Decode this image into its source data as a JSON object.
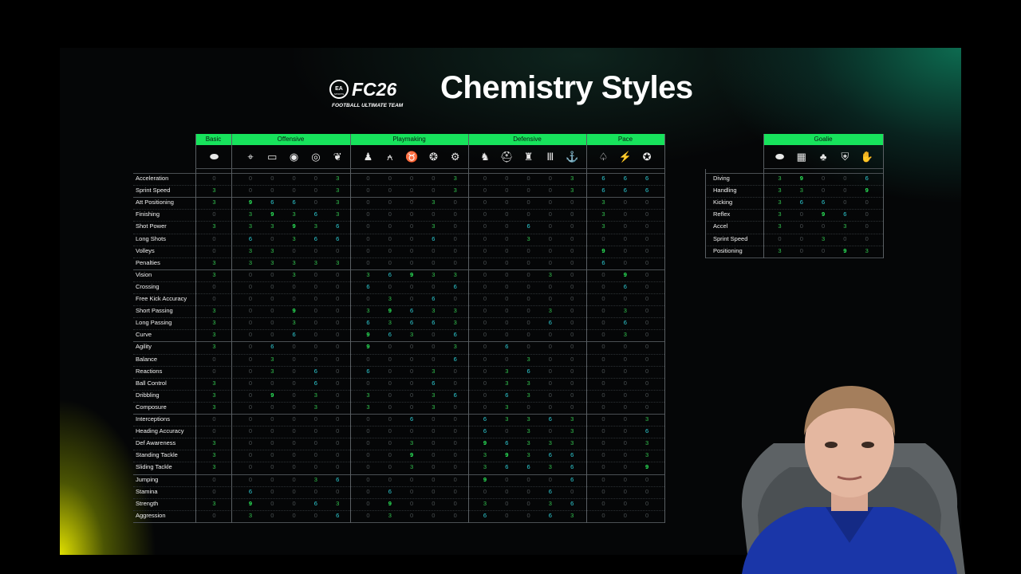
{
  "header": {
    "title": "Chemistry Styles",
    "logo_brand": "FC26",
    "logo_sub": "FOOTBALL ULTIMATE TEAM",
    "logo_top": "EA SPORTS"
  },
  "colors": {
    "accent_green": "#17e35c",
    "three": "#33c24f",
    "six": "#2fd0d8",
    "nine": "#2bea5a",
    "zero": "#4a5052"
  },
  "groups": [
    "Basic",
    "Offensive",
    "Playmaking",
    "Defensive",
    "Pace"
  ],
  "goalie_group": "Goalie",
  "outfield_icons": [
    "boot-icon",
    "crosshair-icon",
    "goal-icon",
    "eye-icon",
    "target-icon",
    "wings-icon",
    "pawn-icon",
    "compass-icon",
    "bull-icon",
    "brain-icon",
    "engine-icon",
    "knight-icon",
    "helmet-icon",
    "soldier-icon",
    "pillar-icon",
    "anchor-icon",
    "fox-icon",
    "lightning-icon",
    "bolt-icon"
  ],
  "goalie_icons": [
    "boot-icon",
    "wall-icon",
    "cat-icon",
    "shield-icon",
    "glove-icon"
  ],
  "outfield_attrs": [
    "Acceleration",
    "Sprint Speed",
    "Att Positioning",
    "Finishing",
    "Shot Power",
    "Long Shots",
    "Volleys",
    "Penalties",
    "Vision",
    "Crossing",
    "Free Kick Accuracy",
    "Short Passing",
    "Long Passing",
    "Curve",
    "Agility",
    "Balance",
    "Reactions",
    "Ball Control",
    "Dribbling",
    "Composure",
    "Interceptions",
    "Heading Accuracy",
    "Def Awareness",
    "Standing Tackle",
    "Sliding Tackle",
    "Jumping",
    "Stamina",
    "Strength",
    "Aggression"
  ],
  "outfield_values": [
    [
      "0",
      "0",
      "0",
      "0",
      "0",
      "3",
      "0",
      "0",
      "0",
      "0",
      "3",
      "0",
      "0",
      "0",
      "0",
      "3",
      "6",
      "6",
      "6"
    ],
    [
      "3",
      "0",
      "0",
      "0",
      "0",
      "3",
      "0",
      "0",
      "0",
      "0",
      "3",
      "0",
      "0",
      "0",
      "0",
      "3",
      "6",
      "6",
      "6"
    ],
    [
      "3",
      "9",
      "6",
      "6",
      "0",
      "3",
      "0",
      "0",
      "0",
      "3",
      "0",
      "0",
      "0",
      "0",
      "0",
      "0",
      "3",
      "0",
      "0"
    ],
    [
      "0",
      "3",
      "9",
      "3",
      "6",
      "3",
      "0",
      "0",
      "0",
      "0",
      "0",
      "0",
      "0",
      "0",
      "0",
      "0",
      "3",
      "0",
      "0"
    ],
    [
      "3",
      "3",
      "3",
      "9",
      "3",
      "6",
      "0",
      "0",
      "0",
      "3",
      "0",
      "0",
      "0",
      "6",
      "0",
      "0",
      "3",
      "0",
      "0"
    ],
    [
      "0",
      "6",
      "0",
      "3",
      "6",
      "6",
      "0",
      "0",
      "0",
      "6",
      "0",
      "0",
      "0",
      "3",
      "0",
      "0",
      "0",
      "0",
      "0"
    ],
    [
      "0",
      "3",
      "3",
      "0",
      "0",
      "0",
      "0",
      "0",
      "0",
      "0",
      "0",
      "0",
      "0",
      "0",
      "0",
      "0",
      "9",
      "0",
      "0"
    ],
    [
      "3",
      "3",
      "3",
      "3",
      "3",
      "3",
      "0",
      "0",
      "0",
      "0",
      "0",
      "0",
      "0",
      "0",
      "0",
      "0",
      "6",
      "0",
      "0"
    ],
    [
      "3",
      "0",
      "0",
      "3",
      "0",
      "0",
      "3",
      "6",
      "9",
      "3",
      "3",
      "0",
      "0",
      "0",
      "3",
      "0",
      "0",
      "9",
      "0"
    ],
    [
      "0",
      "0",
      "0",
      "0",
      "0",
      "0",
      "6",
      "0",
      "0",
      "0",
      "6",
      "0",
      "0",
      "0",
      "0",
      "0",
      "0",
      "6",
      "0"
    ],
    [
      "0",
      "0",
      "0",
      "0",
      "0",
      "0",
      "0",
      "3",
      "0",
      "6",
      "0",
      "0",
      "0",
      "0",
      "0",
      "0",
      "0",
      "0",
      "0"
    ],
    [
      "3",
      "0",
      "0",
      "9",
      "0",
      "0",
      "3",
      "9",
      "6",
      "3",
      "3",
      "0",
      "0",
      "0",
      "3",
      "0",
      "0",
      "3",
      "0"
    ],
    [
      "3",
      "0",
      "0",
      "3",
      "0",
      "0",
      "6",
      "3",
      "6",
      "6",
      "3",
      "0",
      "0",
      "0",
      "6",
      "0",
      "0",
      "6",
      "0"
    ],
    [
      "3",
      "0",
      "0",
      "6",
      "0",
      "0",
      "9",
      "6",
      "3",
      "0",
      "6",
      "0",
      "0",
      "0",
      "0",
      "0",
      "0",
      "3",
      "0"
    ],
    [
      "3",
      "0",
      "6",
      "0",
      "0",
      "0",
      "9",
      "0",
      "0",
      "0",
      "3",
      "0",
      "6",
      "0",
      "0",
      "0",
      "0",
      "0",
      "0"
    ],
    [
      "0",
      "0",
      "3",
      "0",
      "0",
      "0",
      "0",
      "0",
      "0",
      "0",
      "6",
      "0",
      "0",
      "3",
      "0",
      "0",
      "0",
      "0",
      "0"
    ],
    [
      "0",
      "0",
      "3",
      "0",
      "6",
      "0",
      "6",
      "0",
      "0",
      "3",
      "0",
      "0",
      "3",
      "6",
      "0",
      "0",
      "0",
      "0",
      "0"
    ],
    [
      "3",
      "0",
      "0",
      "0",
      "6",
      "0",
      "0",
      "0",
      "0",
      "6",
      "0",
      "0",
      "3",
      "3",
      "0",
      "0",
      "0",
      "0",
      "0"
    ],
    [
      "3",
      "0",
      "9",
      "0",
      "3",
      "0",
      "3",
      "0",
      "0",
      "3",
      "6",
      "0",
      "6",
      "3",
      "0",
      "0",
      "0",
      "0",
      "0"
    ],
    [
      "3",
      "0",
      "0",
      "0",
      "3",
      "0",
      "3",
      "0",
      "0",
      "3",
      "0",
      "0",
      "3",
      "0",
      "0",
      "0",
      "0",
      "0",
      "0"
    ],
    [
      "0",
      "0",
      "0",
      "0",
      "0",
      "0",
      "0",
      "0",
      "6",
      "0",
      "0",
      "6",
      "3",
      "3",
      "6",
      "3",
      "0",
      "0",
      "3"
    ],
    [
      "0",
      "0",
      "0",
      "0",
      "0",
      "0",
      "0",
      "0",
      "0",
      "0",
      "0",
      "6",
      "0",
      "3",
      "0",
      "3",
      "0",
      "0",
      "6"
    ],
    [
      "3",
      "0",
      "0",
      "0",
      "0",
      "0",
      "0",
      "0",
      "3",
      "0",
      "0",
      "9",
      "6",
      "3",
      "3",
      "3",
      "0",
      "0",
      "3"
    ],
    [
      "3",
      "0",
      "0",
      "0",
      "0",
      "0",
      "0",
      "0",
      "9",
      "0",
      "0",
      "3",
      "9",
      "3",
      "6",
      "6",
      "0",
      "0",
      "3"
    ],
    [
      "3",
      "0",
      "0",
      "0",
      "0",
      "0",
      "0",
      "0",
      "3",
      "0",
      "0",
      "3",
      "6",
      "6",
      "3",
      "6",
      "0",
      "0",
      "9"
    ],
    [
      "0",
      "0",
      "0",
      "0",
      "3",
      "6",
      "0",
      "0",
      "0",
      "0",
      "0",
      "9",
      "0",
      "0",
      "0",
      "6",
      "0",
      "0",
      "0"
    ],
    [
      "0",
      "6",
      "0",
      "0",
      "0",
      "0",
      "0",
      "6",
      "0",
      "0",
      "0",
      "0",
      "0",
      "0",
      "6",
      "0",
      "0",
      "0",
      "0"
    ],
    [
      "3",
      "9",
      "0",
      "0",
      "6",
      "3",
      "0",
      "9",
      "0",
      "0",
      "0",
      "3",
      "0",
      "0",
      "3",
      "6",
      "0",
      "0",
      "0"
    ],
    [
      "0",
      "3",
      "0",
      "0",
      "0",
      "6",
      "0",
      "3",
      "0",
      "0",
      "0",
      "6",
      "0",
      "0",
      "6",
      "3",
      "0",
      "0",
      "0"
    ]
  ],
  "goalie_attrs": [
    "Diving",
    "Handling",
    "Kicking",
    "Reflex",
    "Accel",
    "Sprint Speed",
    "Positioning"
  ],
  "goalie_values": [
    [
      "3",
      "9",
      "0",
      "0",
      "6"
    ],
    [
      "3",
      "3",
      "0",
      "0",
      "9"
    ],
    [
      "3",
      "6",
      "6",
      "0",
      "0"
    ],
    [
      "3",
      "0",
      "9",
      "6",
      "0"
    ],
    [
      "3",
      "0",
      "0",
      "3",
      "0"
    ],
    [
      "0",
      "0",
      "3",
      "0",
      "0"
    ],
    [
      "3",
      "0",
      "0",
      "9",
      "3"
    ]
  ]
}
